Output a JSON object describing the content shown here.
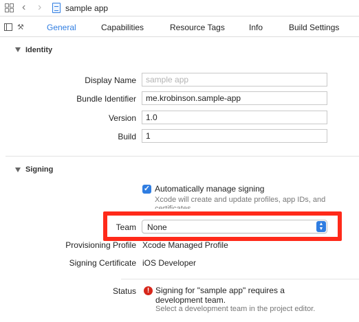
{
  "breadcrumb": {
    "file": "sample app"
  },
  "tabs": [
    "General",
    "Capabilities",
    "Resource Tags",
    "Info",
    "Build Settings"
  ],
  "identity": {
    "section_title": "Identity",
    "display_name_label": "Display Name",
    "display_name_placeholder": "sample app",
    "bundle_identifier_label": "Bundle Identifier",
    "bundle_identifier_value": "me.krobinson.sample-app",
    "version_label": "Version",
    "version_value": "1.0",
    "build_label": "Build",
    "build_value": "1"
  },
  "signing": {
    "section_title": "Signing",
    "auto_manage_label": "Automatically manage signing",
    "auto_manage_checked": true,
    "auto_manage_hint_line1": "Xcode will create and update profiles, app IDs, and",
    "auto_manage_hint_line2": "certificates.",
    "team_label": "Team",
    "team_value": "None",
    "provisioning_profile_label": "Provisioning Profile",
    "provisioning_profile_value": "Xcode Managed Profile",
    "signing_certificate_label": "Signing Certificate",
    "signing_certificate_value": "iOS Developer",
    "status_label": "Status",
    "status_line1": "Signing for \"sample app\" requires a",
    "status_line2": "development team.",
    "status_hint": "Select a development team in the project editor."
  },
  "colors": {
    "accent": "#2f7de1",
    "highlight": "#ff2a1a",
    "error": "#d7271b"
  },
  "icons": {
    "navigator": "grid-icon",
    "back": "chevron-left-icon",
    "forward": "chevron-right-icon",
    "project": "project-file-icon",
    "sidebar": "sidebar-toggle-icon",
    "target": "target-icon",
    "error": "error-icon",
    "checkbox": "checkmark-icon",
    "select": "stepper-icon"
  }
}
